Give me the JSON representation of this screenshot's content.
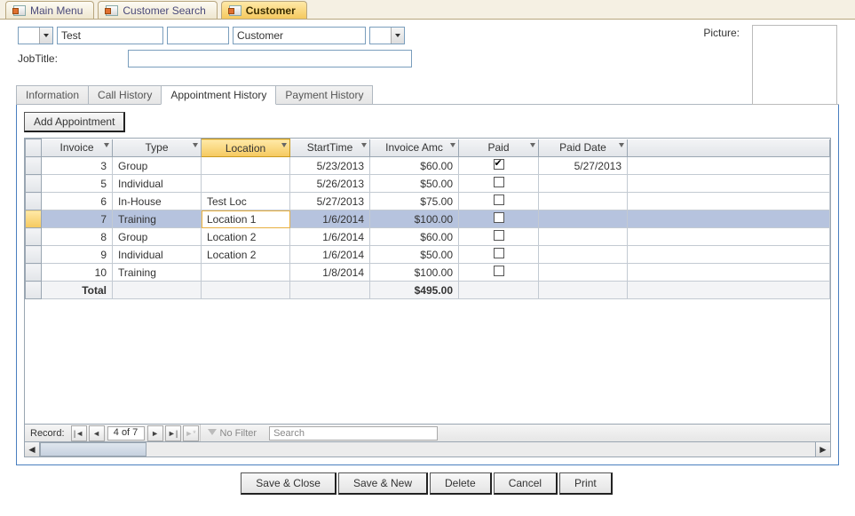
{
  "window_tabs": [
    {
      "label": "Main Menu",
      "active": false
    },
    {
      "label": "Customer Search",
      "active": false
    },
    {
      "label": "Customer",
      "active": true
    }
  ],
  "form": {
    "title_prefix": "",
    "first_name": "Test",
    "middle": "",
    "last_name": "Customer",
    "suffix": "",
    "jobtitle_label": "JobTitle:",
    "jobtitle_value": "",
    "picture_label": "Picture:"
  },
  "detail_tabs": [
    {
      "label": "Information",
      "active": false
    },
    {
      "label": "Call History",
      "active": false
    },
    {
      "label": "Appointment History",
      "active": true
    },
    {
      "label": "Payment History",
      "active": false
    }
  ],
  "add_btn": "Add Appointment",
  "columns": [
    "Invoice",
    "Type",
    "Location",
    "StartTime",
    "Invoice Amc",
    "Paid",
    "Paid Date"
  ],
  "selected_col": 2,
  "selected_row": 3,
  "rows": [
    {
      "invoice": "3",
      "type": "Group",
      "location": "",
      "start": "5/23/2013",
      "amt": "$60.00",
      "paid": true,
      "paid_date": "5/27/2013"
    },
    {
      "invoice": "5",
      "type": "Individual",
      "location": "",
      "start": "5/26/2013",
      "amt": "$50.00",
      "paid": false,
      "paid_date": ""
    },
    {
      "invoice": "6",
      "type": "In-House",
      "location": "Test Loc",
      "start": "5/27/2013",
      "amt": "$75.00",
      "paid": false,
      "paid_date": ""
    },
    {
      "invoice": "7",
      "type": "Training",
      "location": "Location 1",
      "start": "1/6/2014",
      "amt": "$100.00",
      "paid": false,
      "paid_date": ""
    },
    {
      "invoice": "8",
      "type": "Group",
      "location": "Location 2",
      "start": "1/6/2014",
      "amt": "$60.00",
      "paid": false,
      "paid_date": ""
    },
    {
      "invoice": "9",
      "type": "Individual",
      "location": "Location 2",
      "start": "1/6/2014",
      "amt": "$50.00",
      "paid": false,
      "paid_date": ""
    },
    {
      "invoice": "10",
      "type": "Training",
      "location": "",
      "start": "1/8/2014",
      "amt": "$100.00",
      "paid": false,
      "paid_date": ""
    }
  ],
  "total": {
    "label": "Total",
    "amt": "$495.00"
  },
  "recnav": {
    "label": "Record:",
    "position": "4 of 7",
    "nofilter": "No Filter",
    "search_placeholder": "Search"
  },
  "actions": [
    "Save & Close",
    "Save & New",
    "Delete",
    "Cancel",
    "Print"
  ]
}
